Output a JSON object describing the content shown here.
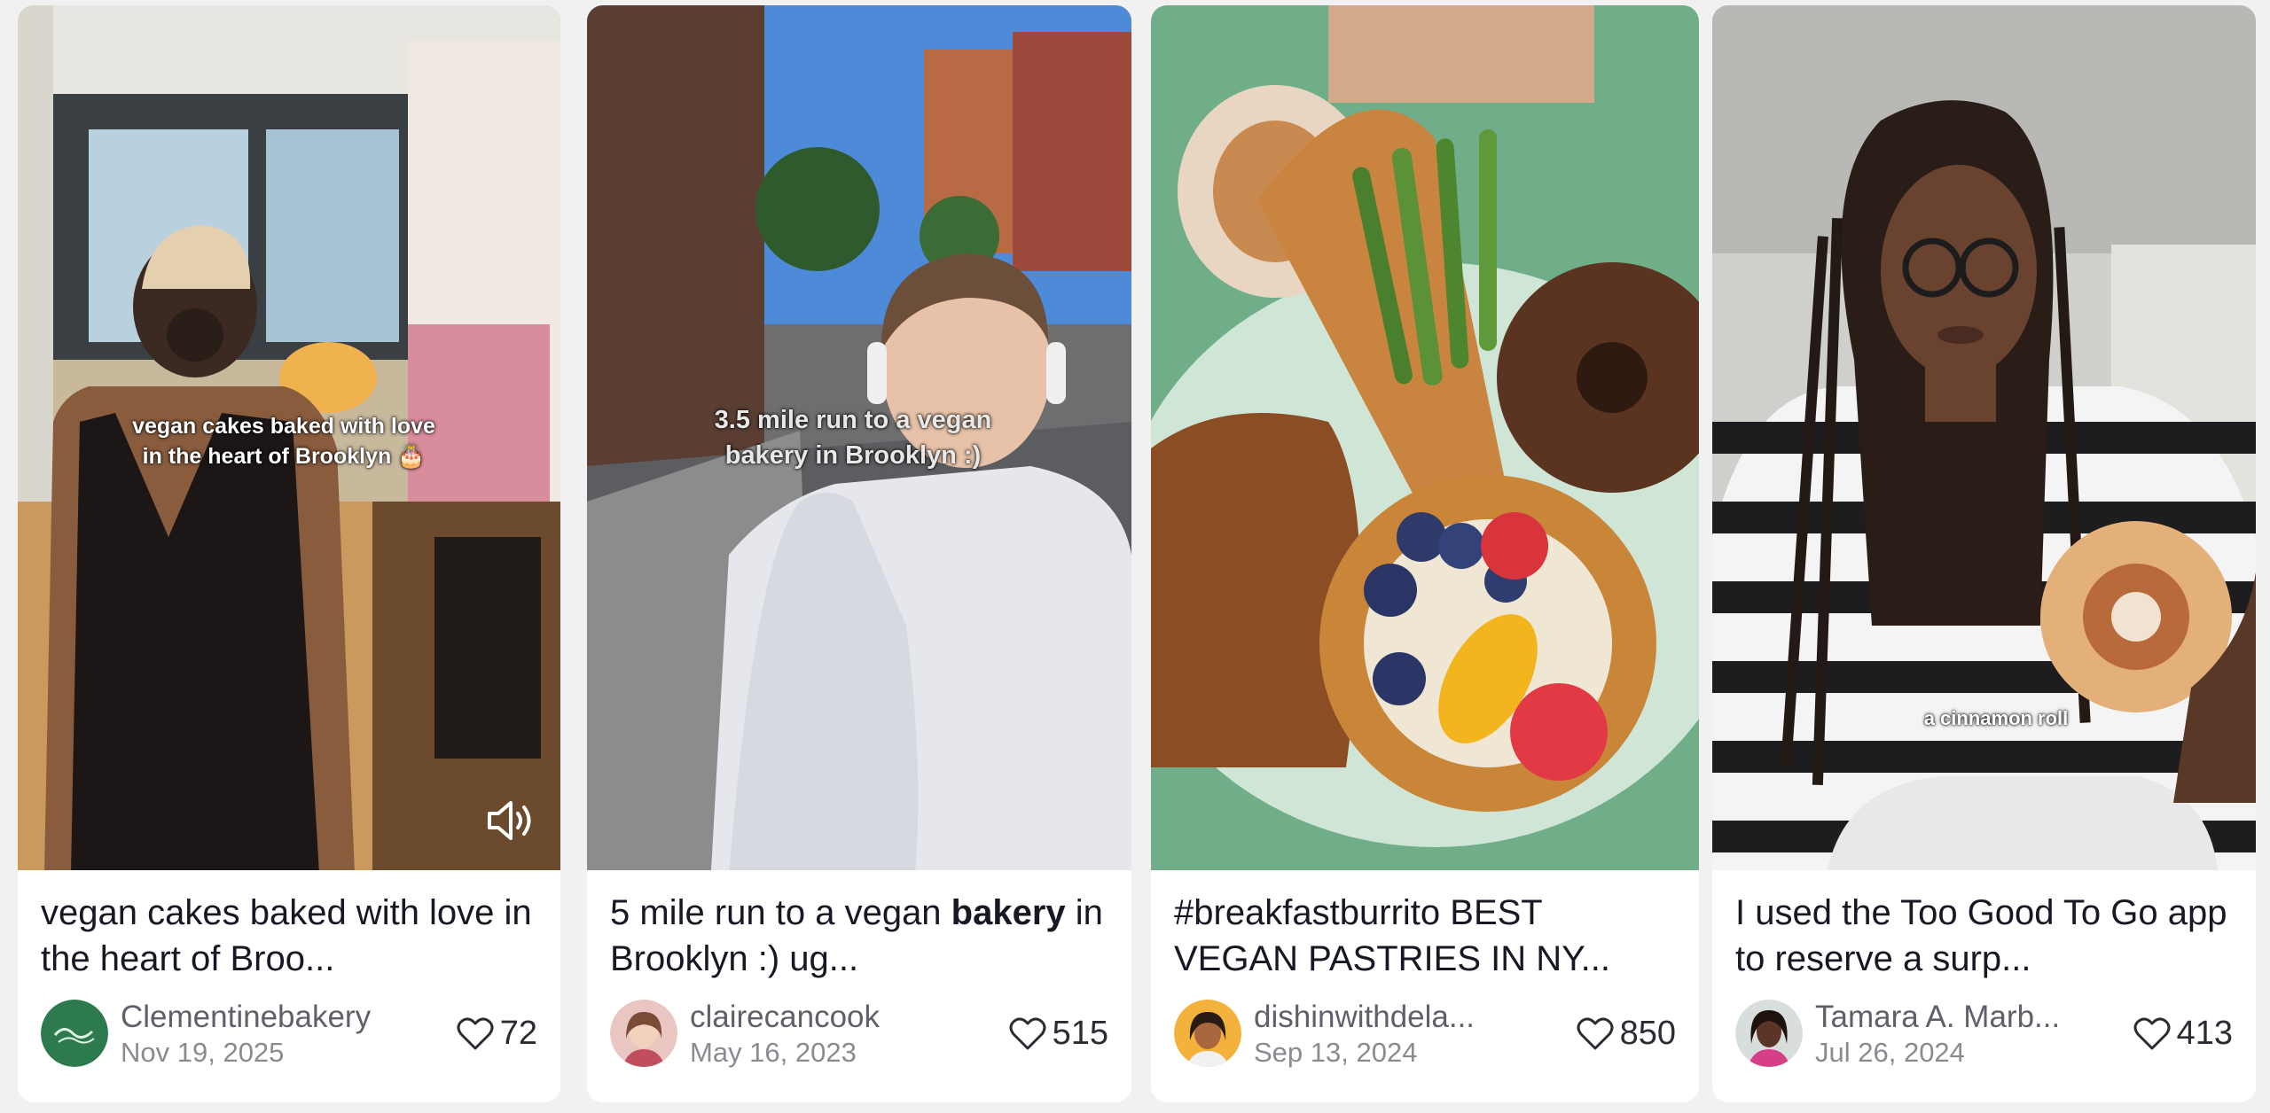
{
  "cards": [
    {
      "title": "vegan cakes baked with love in the heart of Broo...",
      "overlay": "vegan cakes baked with love\nin the heart of Brooklyn 🎂",
      "author": "Clementinebakery",
      "date": "Nov 19, 2025",
      "likes": "72",
      "icons": [
        "avatar-logo",
        "speaker-icon",
        "heart-icon"
      ]
    },
    {
      "title_parts": [
        "5 mile run to a vegan ",
        "bakery",
        " in Brooklyn :) ug..."
      ],
      "overlay": "3.5 mile run to a vegan\nbakery in Brooklyn :)",
      "author": "clairecancook",
      "date": "May 16, 2023",
      "likes": "515"
    },
    {
      "title": "#breakfastburrito BEST VEGAN PASTRIES IN NY...",
      "author": "dishinwithdela...",
      "date": "Sep 13, 2024",
      "likes": "850"
    },
    {
      "title": "I used the Too Good To Go app to reserve a surp...",
      "overlay": "a cinnamon roll",
      "author": "Tamara A. Marb...",
      "date": "Jul 26, 2024",
      "likes": "413"
    }
  ],
  "colors": {
    "page_bg": "#f1f1f2",
    "card_bg": "#ffffff",
    "title_text": "#161823",
    "meta_text": "#8a8b91",
    "avatar_green": "#2d7a4f"
  }
}
